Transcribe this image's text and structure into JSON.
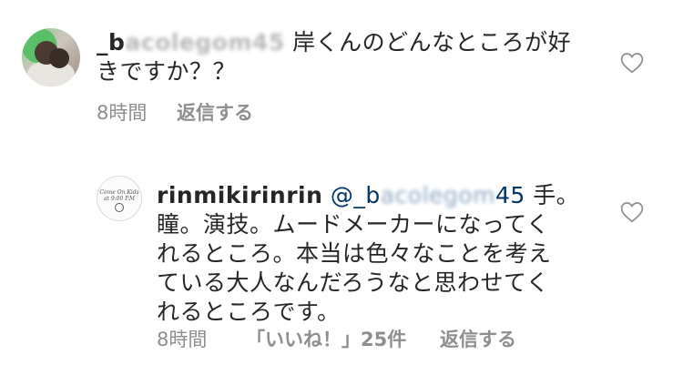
{
  "comments": [
    {
      "username_prefix": "_b",
      "username_blurred": "acolegom",
      "username_suffix": "45",
      "text_line1": " 岸くんのどんなところが好",
      "text_line2": "きですか？？",
      "time": "8時間",
      "reply_label": "返信する",
      "avatar_icon": "profile-photo"
    },
    {
      "username": "rinmikirinrin",
      "mention_prefix": "@_b",
      "mention_blurred": "acolegom",
      "mention_suffix": "45",
      "text_line1": " 手。",
      "text_line2": "瞳。演技。ムードメーカーになってく",
      "text_line3": "れるところ。本当は色々なことを考え",
      "text_line4": "ている大人なんだろうなと思わせてく",
      "text_line5": "れるところです。",
      "time": "8時間",
      "likes_label": "「いいね！」25件",
      "reply_label": "返信する",
      "avatar_icon": "brand-logo",
      "avatar_logo_text": "Come On Kids\nat 9:00 P.M"
    }
  ]
}
